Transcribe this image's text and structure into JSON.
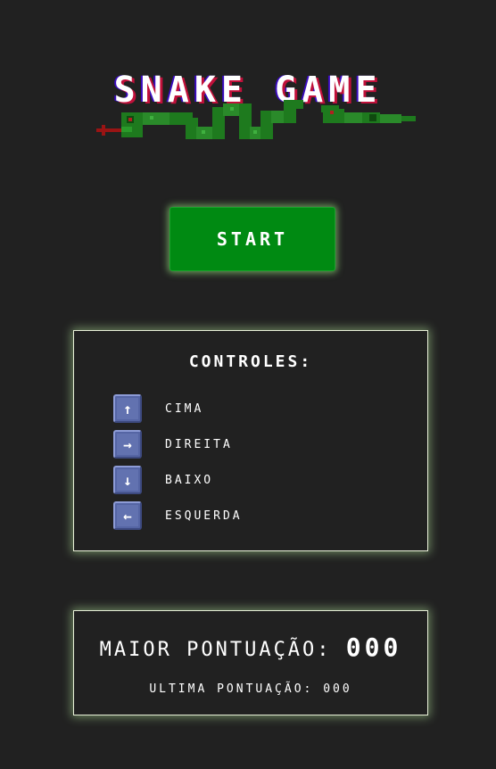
{
  "title": "SNAKE GAME",
  "start_button": "START",
  "controls": {
    "title": "CONTROLES:",
    "items": [
      {
        "icon": "arrow-up-icon",
        "symbol": "↑",
        "label": "CIMA"
      },
      {
        "icon": "arrow-right-icon",
        "symbol": "→",
        "label": "DIREITA"
      },
      {
        "icon": "arrow-down-icon",
        "symbol": "↓",
        "label": "BAIXO"
      },
      {
        "icon": "arrow-left-icon",
        "symbol": "←",
        "label": "ESQUERDA"
      }
    ]
  },
  "scores": {
    "best_label": "MAIOR PONTUAÇÃO:",
    "best_value": "000",
    "last_label": "ULTIMA PONTUAÇÃO:",
    "last_value": "000"
  },
  "colors": {
    "background": "#212121",
    "start_button": "#008a12",
    "snake_green": "#1e7a1e",
    "key_blue": "#6272b0",
    "panel_border": "#e8f0d8"
  }
}
